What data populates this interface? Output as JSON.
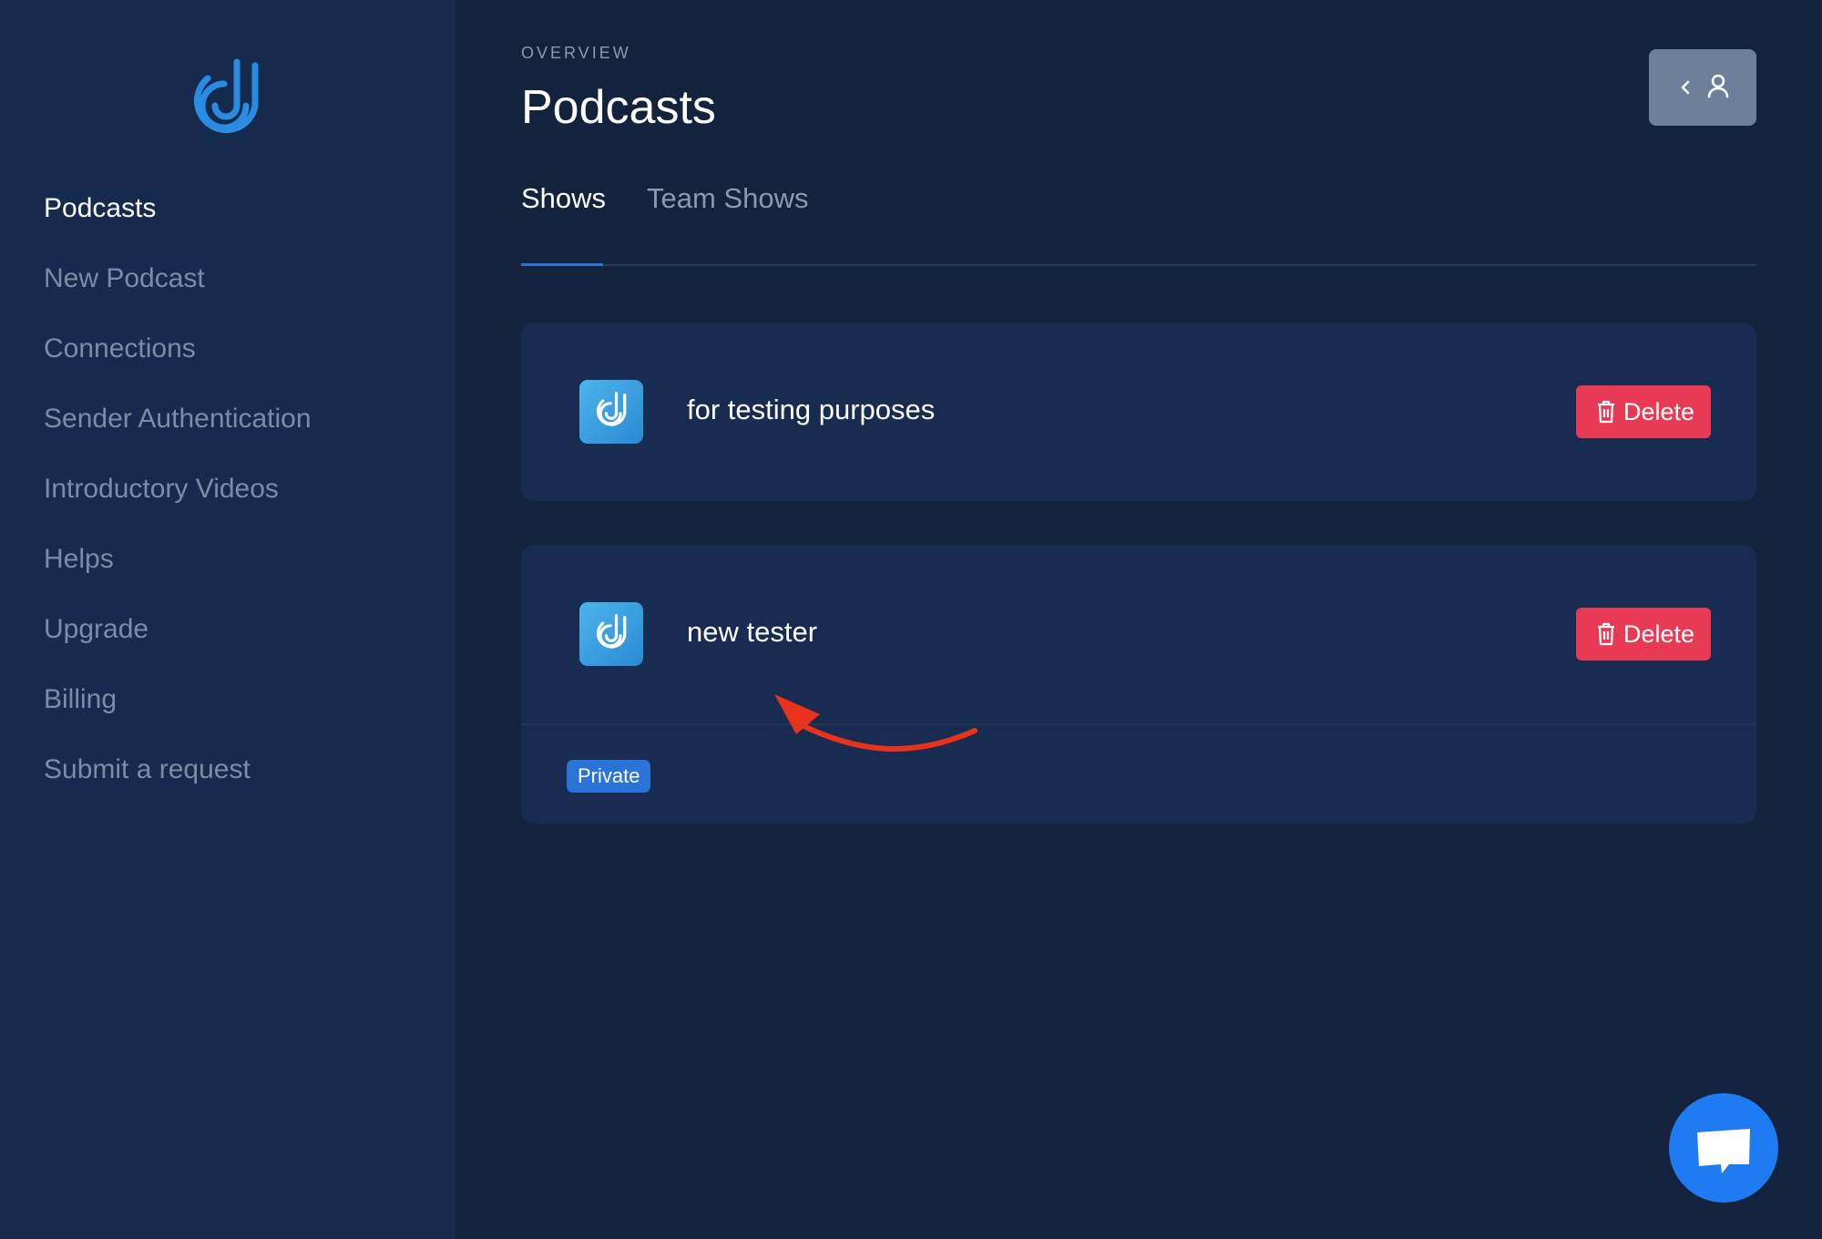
{
  "brand": {
    "logo_icon": "brand-swirl-icon",
    "accent_color": "#2a8ce0"
  },
  "sidebar": {
    "items": [
      {
        "label": "Podcasts",
        "active": true
      },
      {
        "label": "New Podcast",
        "active": false
      },
      {
        "label": "Connections",
        "active": false
      },
      {
        "label": "Sender Authentication",
        "active": false
      },
      {
        "label": "Introductory Videos",
        "active": false
      },
      {
        "label": "Helps",
        "active": false
      },
      {
        "label": "Upgrade",
        "active": false
      },
      {
        "label": "Billing",
        "active": false
      },
      {
        "label": "Submit a request",
        "active": false
      }
    ]
  },
  "header": {
    "eyebrow": "OVERVIEW",
    "title": "Podcasts",
    "profile_button_icons": [
      "chevron-left-icon",
      "user-icon"
    ]
  },
  "tabs": [
    {
      "label": "Shows",
      "active": true
    },
    {
      "label": "Team Shows",
      "active": false
    }
  ],
  "shows": [
    {
      "title": "for testing purposes",
      "delete_label": "Delete",
      "badge": null
    },
    {
      "title": "new tester",
      "delete_label": "Delete",
      "badge": "Private"
    }
  ],
  "colors": {
    "delete": "#e93a55",
    "badge": "#2a73d8",
    "annotation_arrow": "#e8321c",
    "chat_button": "#1f7bf2"
  },
  "chat": {
    "icon": "chat-bubble-icon"
  }
}
